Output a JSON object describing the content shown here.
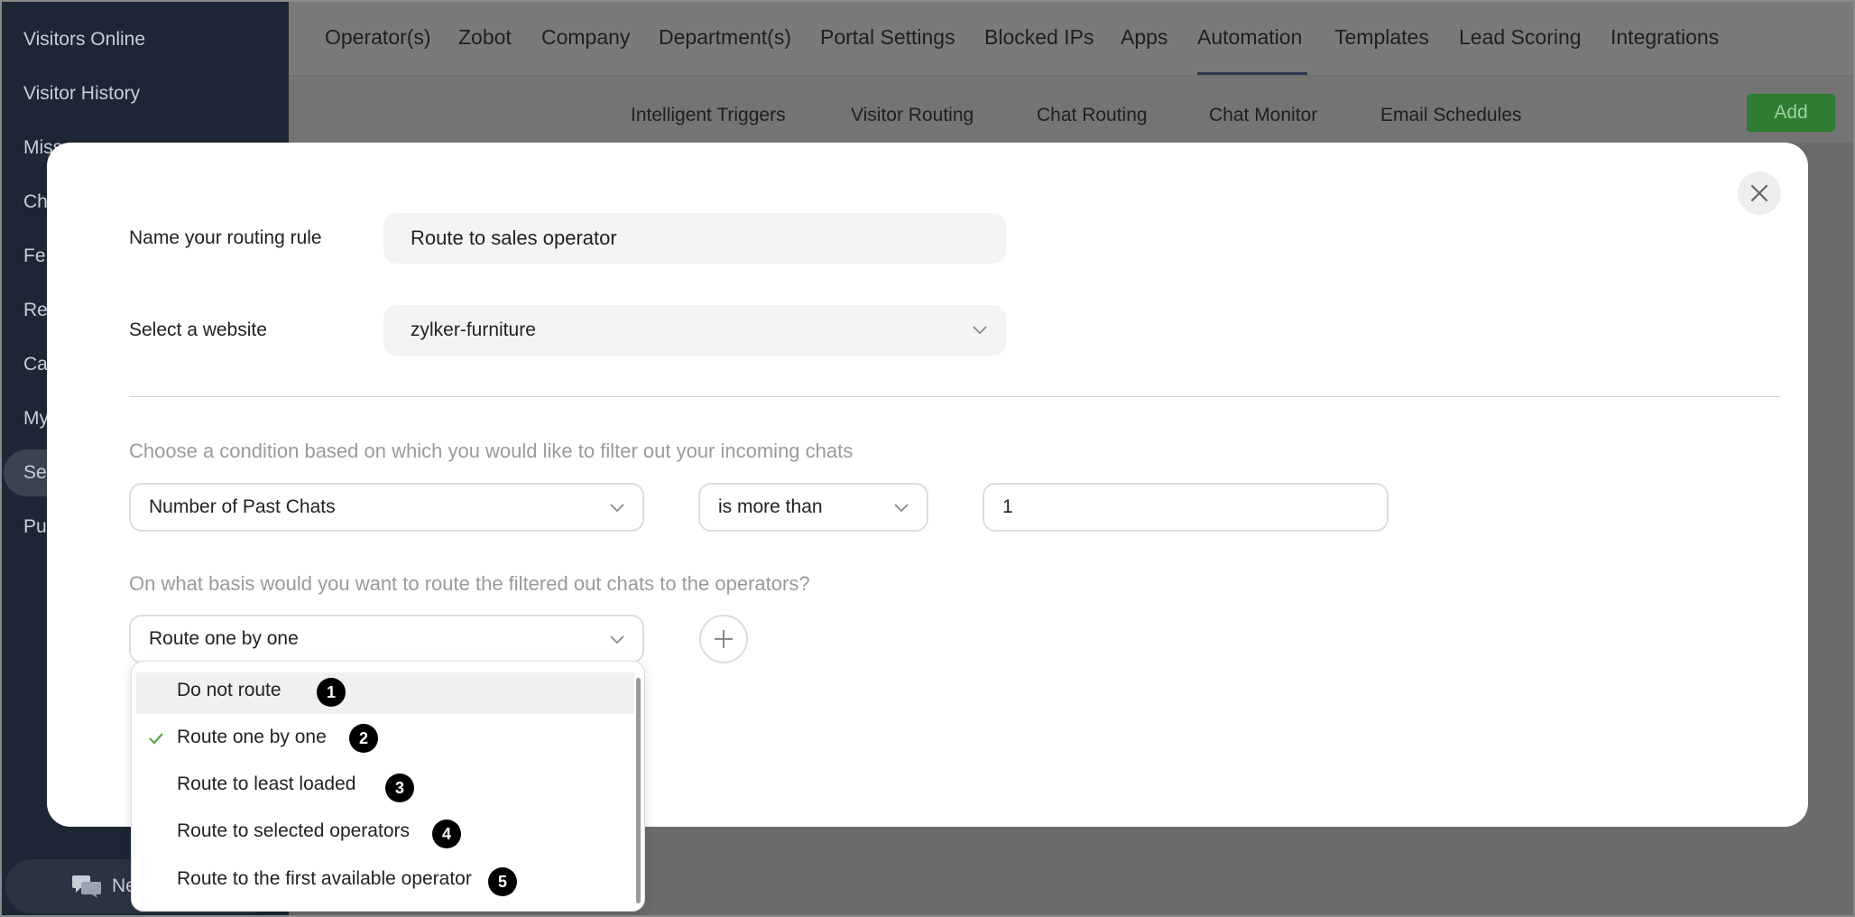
{
  "sidebar": {
    "items": [
      {
        "label": "Visitors Online"
      },
      {
        "label": "Visitor History"
      },
      {
        "label": "Miss"
      },
      {
        "label": "Ch"
      },
      {
        "label": "Fe"
      },
      {
        "label": "Re"
      },
      {
        "label": "Ca"
      },
      {
        "label": "My"
      },
      {
        "label": "Se"
      },
      {
        "label": "Pu"
      }
    ],
    "new_chat_label": "Ne"
  },
  "topnav": {
    "tabs": [
      {
        "label": "Operator(s)"
      },
      {
        "label": "Zobot"
      },
      {
        "label": "Company"
      },
      {
        "label": "Department(s)"
      },
      {
        "label": "Portal Settings"
      },
      {
        "label": "Blocked IPs"
      },
      {
        "label": "Apps"
      },
      {
        "label": "Automation"
      },
      {
        "label": "Templates"
      },
      {
        "label": "Lead Scoring"
      },
      {
        "label": "Integrations"
      }
    ],
    "active_tab": "Automation"
  },
  "subnav": {
    "tabs": [
      {
        "label": "Intelligent Triggers"
      },
      {
        "label": "Visitor Routing"
      },
      {
        "label": "Chat Routing"
      },
      {
        "label": "Chat Monitor"
      },
      {
        "label": "Email Schedules"
      }
    ],
    "add_label": "Add"
  },
  "modal": {
    "rule_name_label": "Name your routing rule",
    "rule_name_value": "Route to sales operator",
    "website_label": "Select a website",
    "website_value": "zylker-furniture",
    "condition_question": "Choose a condition based on which you would like to filter out your incoming chats",
    "condition_field": "Number of Past Chats",
    "condition_operator": "is more than",
    "condition_value": "1",
    "routing_question": "On what basis would you want to route the filtered out chats to the operators?",
    "routing_selected": "Route one by one",
    "routing_options": [
      {
        "label": "Do not route",
        "badge": "1"
      },
      {
        "label": "Route one by one",
        "badge": "2"
      },
      {
        "label": "Route to least loaded",
        "badge": "3"
      },
      {
        "label": "Route to selected operators",
        "badge": "4"
      },
      {
        "label": "Route to the first available operator",
        "badge": "5"
      }
    ]
  },
  "colors": {
    "sidebar_bg": "#1d2634",
    "add_button": "#2e7d32",
    "check_green": "#5aa84a",
    "badge": "#000000"
  },
  "icons": {
    "close": "close-icon",
    "chevron": "chevron-down-icon",
    "plus": "plus-icon",
    "check": "check-icon",
    "chat": "chat-bubbles-icon"
  }
}
